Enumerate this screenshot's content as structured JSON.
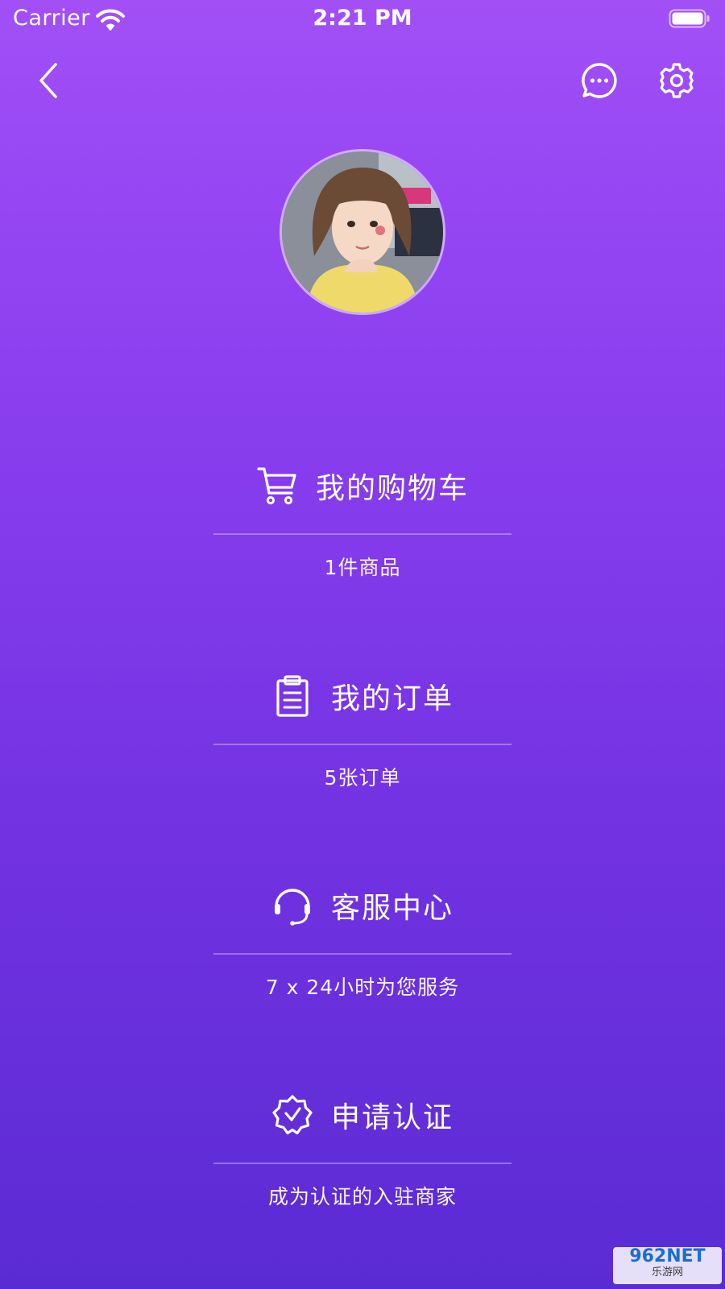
{
  "status_bar": {
    "carrier": "Carrier",
    "time": "2:21 PM"
  },
  "nav": {
    "back_icon": "chevron-left-icon",
    "message_icon": "chat-bubble-icon",
    "settings_icon": "gear-icon"
  },
  "profile": {
    "avatar": "user-avatar"
  },
  "menu": [
    {
      "icon": "shopping-cart-icon",
      "title": "我的购物车",
      "subtitle": "1件商品"
    },
    {
      "icon": "clipboard-icon",
      "title": "我的订单",
      "subtitle": "5张订单"
    },
    {
      "icon": "headset-icon",
      "title": "客服中心",
      "subtitle": "7 x 24小时为您服务"
    },
    {
      "icon": "verified-badge-icon",
      "title": "申请认证",
      "subtitle": "成为认证的入驻商家"
    }
  ],
  "watermark": {
    "brand": "962NET",
    "sub": "乐游网"
  },
  "colors": {
    "gradient_top": "#a24ff6",
    "gradient_bottom": "#5a2bd3",
    "text": "#ffffff"
  }
}
